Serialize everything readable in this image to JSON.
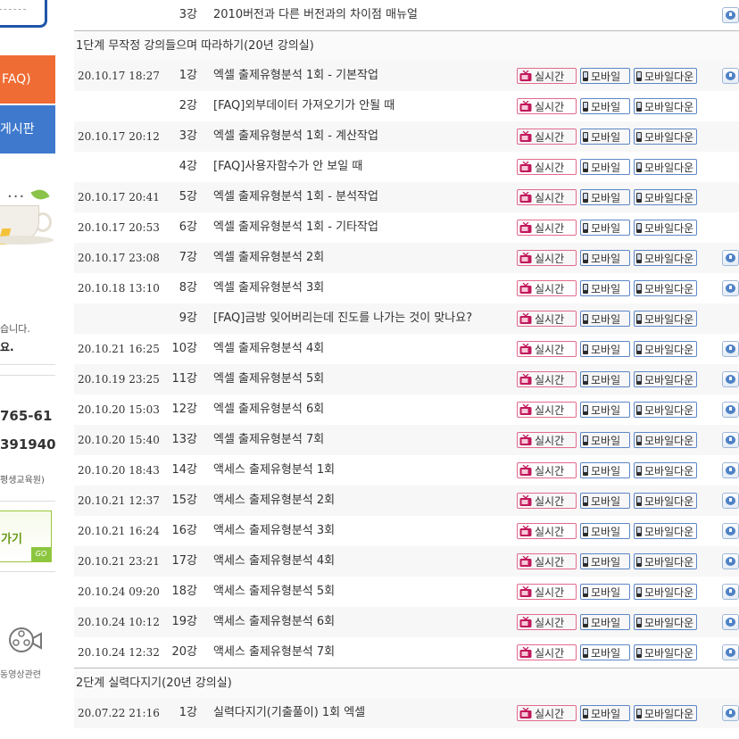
{
  "sidebar": {
    "faq_label": "FAQ)",
    "board_label": "게시판",
    "dots": "···",
    "note_line1": "습니다.",
    "note_line2": "요.",
    "phone1": "765-61",
    "phone2": "391940",
    "org_label": "평생교육원)",
    "go_label": "가기",
    "go_badge": "GO",
    "video_label": "동영상관련"
  },
  "buttons": {
    "live": "실시간",
    "mobile": "모바일",
    "mobile_down": "모바일다운"
  },
  "icons": {
    "live": "tv-icon",
    "mobile": "phone-icon",
    "mobile_down": "phone-download-icon",
    "download": "download-icon",
    "film": "film-reel-icon"
  },
  "top_row": {
    "date": "",
    "num": "3강",
    "title": "2010버전과 다른 버전과의 차이점 매뉴얼",
    "buttons": false,
    "download": true
  },
  "sections": [
    {
      "label": "1단계 무작정 강의들으며 따라하기(20년 강의실)",
      "rows": [
        {
          "date": "20.10.17 18:27",
          "num": "1강",
          "title": "엑셀 출제유형분석 1회 - 기본작업",
          "download": true
        },
        {
          "date": "",
          "num": "2강",
          "title": "[FAQ]외부데이터 가져오기가 안될 때",
          "download": false
        },
        {
          "date": "20.10.17 20:12",
          "num": "3강",
          "title": "엑셀 출제유형분석 1회 - 계산작업",
          "download": false
        },
        {
          "date": "",
          "num": "4강",
          "title": "[FAQ]사용자함수가 안 보일 때",
          "download": false
        },
        {
          "date": "20.10.17 20:41",
          "num": "5강",
          "title": "엑셀 출제유형분석 1회 - 분석작업",
          "download": false
        },
        {
          "date": "20.10.17 20:53",
          "num": "6강",
          "title": "엑셀 출제유형분석 1회 - 기타작업",
          "download": false
        },
        {
          "date": "20.10.17 23:08",
          "num": "7강",
          "title": "엑셀 출제유형분석 2회",
          "download": true
        },
        {
          "date": "20.10.18 13:10",
          "num": "8강",
          "title": "엑셀 출제유형분석 3회",
          "download": true
        },
        {
          "date": "",
          "num": "9강",
          "title": "[FAQ]금방 잊어버리는데 진도를 나가는 것이 맞나요?",
          "download": false
        },
        {
          "date": "20.10.21 16:25",
          "num": "10강",
          "title": "엑셀 출제유형분석 4회",
          "download": true
        },
        {
          "date": "20.10.19 23:25",
          "num": "11강",
          "title": "엑셀 출제유형분석 5회",
          "download": true
        },
        {
          "date": "20.10.20 15:03",
          "num": "12강",
          "title": "엑셀 출제유형분석 6회",
          "download": true
        },
        {
          "date": "20.10.20 15:40",
          "num": "13강",
          "title": "엑셀 출제유형분석 7회",
          "download": true
        },
        {
          "date": "20.10.20 18:43",
          "num": "14강",
          "title": "액세스 출제유형분석 1회",
          "download": true
        },
        {
          "date": "20.10.21 12:37",
          "num": "15강",
          "title": "액세스 출제유형분석 2회",
          "download": true
        },
        {
          "date": "20.10.21 16:24",
          "num": "16강",
          "title": "액세스 출제유형분석 3회",
          "download": true
        },
        {
          "date": "20.10.21 23:21",
          "num": "17강",
          "title": "액세스 출제유형분석 4회",
          "download": true
        },
        {
          "date": "20.10.24 09:20",
          "num": "18강",
          "title": "액세스 출제유형분석 5회",
          "download": true
        },
        {
          "date": "20.10.24 10:12",
          "num": "19강",
          "title": "액세스 출제유형분석 6회",
          "download": true
        },
        {
          "date": "20.10.24 12:32",
          "num": "20강",
          "title": "액세스 출제유형분석 7회",
          "download": true
        }
      ]
    },
    {
      "label": "2단계 실력다지기(20년 강의실)",
      "rows": [
        {
          "date": "20.07.22 21:16",
          "num": "1강",
          "title": "실력다지기(기출풀이) 1회 엑셀",
          "download": true
        }
      ]
    }
  ]
}
